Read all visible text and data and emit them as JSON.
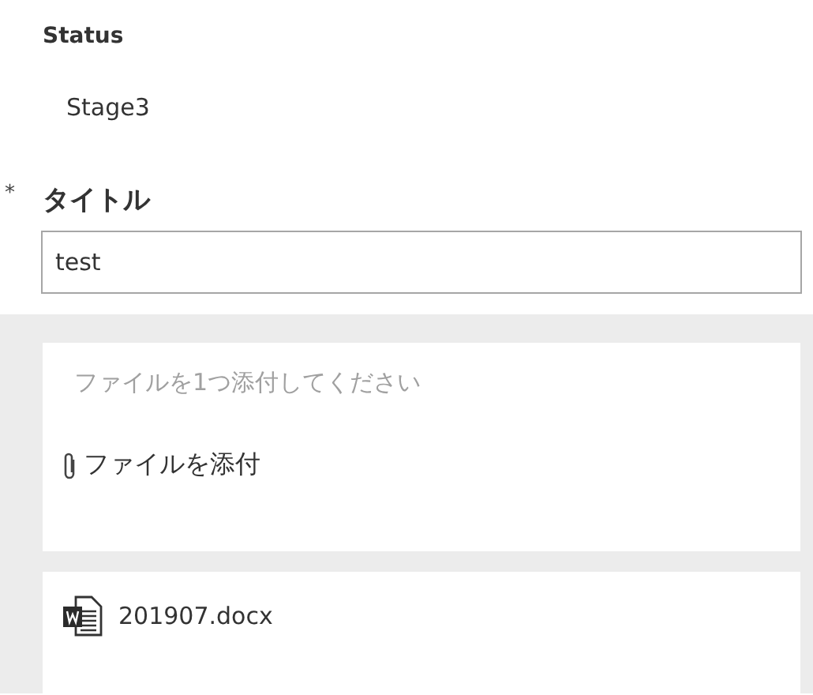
{
  "status": {
    "label": "Status",
    "value": "Stage3"
  },
  "title_field": {
    "label": "タイトル",
    "required": true,
    "required_mark": "*",
    "value": "test"
  },
  "attachments": {
    "hint": "ファイルを1つ添付してください",
    "attach_link": "ファイルを添付",
    "files": [
      {
        "name": "201907.docx",
        "kind": "word"
      }
    ]
  }
}
